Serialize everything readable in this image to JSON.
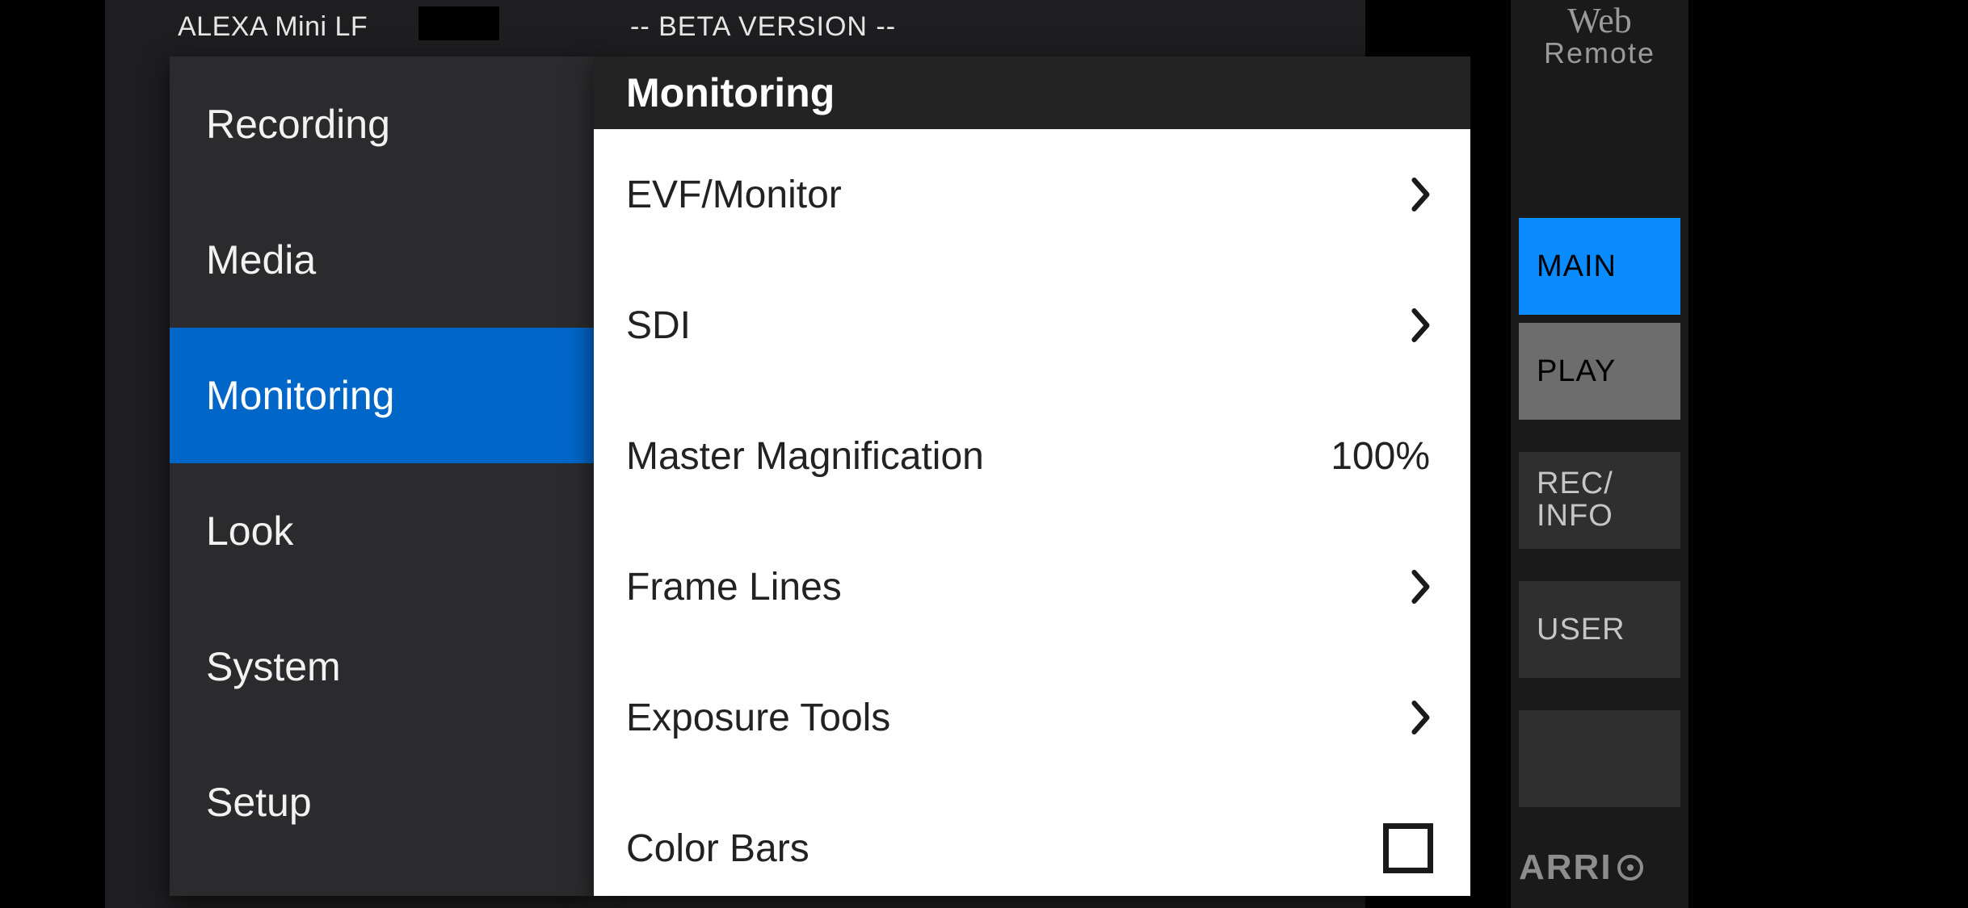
{
  "header": {
    "device": "ALEXA Mini LF",
    "beta": "-- BETA VERSION --"
  },
  "webremote_line1": "Web",
  "webremote_line2": "Remote",
  "brand": "ARRI",
  "sidemenu": {
    "items": [
      {
        "label": "Recording",
        "selected": false
      },
      {
        "label": "Media",
        "selected": false
      },
      {
        "label": "Monitoring",
        "selected": true
      },
      {
        "label": "Look",
        "selected": false
      },
      {
        "label": "System",
        "selected": false
      },
      {
        "label": "Setup",
        "selected": false
      }
    ]
  },
  "content": {
    "title": "Monitoring",
    "rows": [
      {
        "label": "EVF/Monitor",
        "kind": "nav"
      },
      {
        "label": "SDI",
        "kind": "nav"
      },
      {
        "label": "Master Magnification",
        "kind": "value",
        "value": "100%"
      },
      {
        "label": "Frame Lines",
        "kind": "nav"
      },
      {
        "label": "Exposure Tools",
        "kind": "nav"
      },
      {
        "label": "Color Bars",
        "kind": "check",
        "checked": false
      }
    ]
  },
  "rightstrip": {
    "buttons": [
      {
        "label": "MAIN",
        "style": "main"
      },
      {
        "label": "PLAY",
        "style": "play"
      },
      {
        "label": "REC/\nINFO",
        "style": "default"
      },
      {
        "label": "USER",
        "style": "default"
      },
      {
        "label": "",
        "style": "default"
      }
    ]
  }
}
